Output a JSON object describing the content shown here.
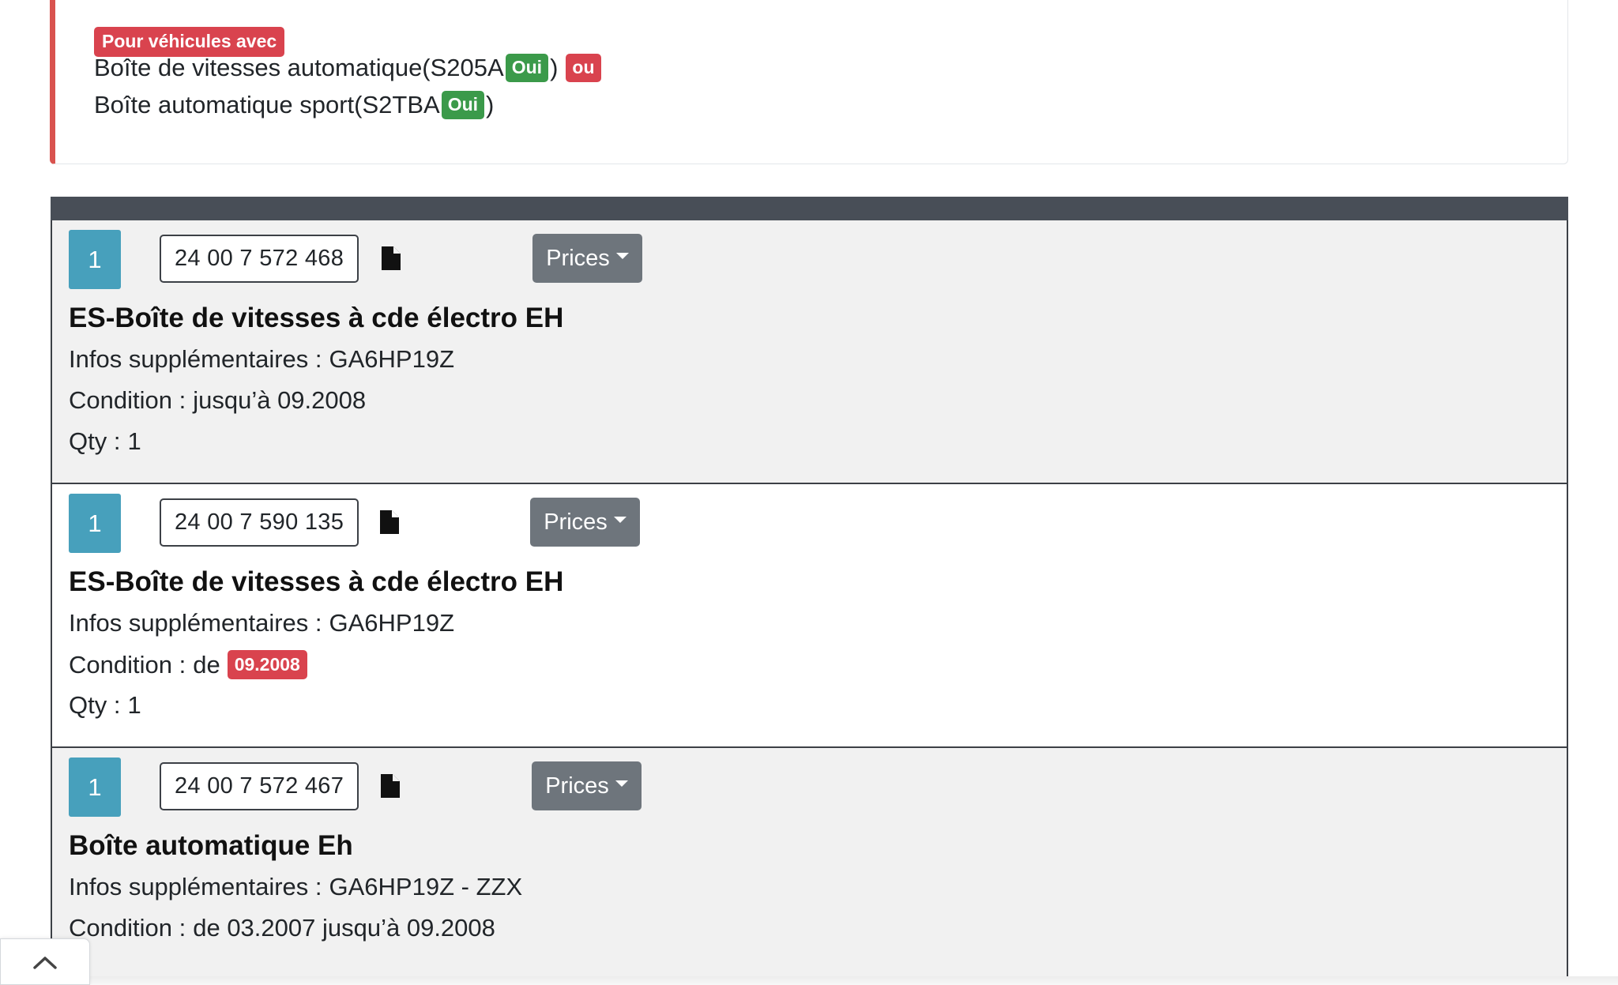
{
  "notice": {
    "title_badge": "Pour véhicules avec",
    "line1_text": "Boîte de vitesses automatique(S205A",
    "line1_badge": "Oui",
    "line1_close": ")",
    "or_badge": "ou",
    "line2_text": "Boîte automatique sport(S2TBA",
    "line2_badge": "Oui",
    "line2_close": ")",
    "accent_color": "#d9534f"
  },
  "parts": [
    {
      "position": "1",
      "part_number": "24 00 7 572 468",
      "prices_label": "Prices",
      "title": "ES-Boîte de vitesses à cde électro EH",
      "info_label": "Infos supplémentaires :",
      "info_value": "GA6HP19Z",
      "condition_label": "Condition :",
      "condition_value": "jusqu’à 09.2008",
      "qty_label": "Qty :",
      "qty_value": "1"
    },
    {
      "position": "1",
      "part_number": "24 00 7 590 135",
      "prices_label": "Prices",
      "title": "ES-Boîte de vitesses à cde électro EH",
      "info_label": "Infos supplémentaires :",
      "info_value": "GA6HP19Z",
      "condition_label": "Condition :",
      "condition_prefix": "de",
      "condition_badge": "09.2008",
      "qty_label": "Qty :",
      "qty_value": "1"
    },
    {
      "position": "1",
      "part_number": "24 00 7 572 467",
      "prices_label": "Prices",
      "title": "Boîte automatique Eh",
      "info_label": "Infos supplémentaires :",
      "info_value": "GA6HP19Z - ZZX",
      "condition_label": "Condition :",
      "condition_value": "de 03.2007 jusqu’à 09.2008"
    }
  ],
  "icons": {
    "document": "document-icon",
    "scroll_top": "chevron-up-icon"
  },
  "colors": {
    "position_badge": "#47a0bc",
    "prices_button": "#6e757c",
    "red_badge": "#d9434e",
    "green_badge": "#3b9a4a",
    "list_header": "#484e57"
  }
}
